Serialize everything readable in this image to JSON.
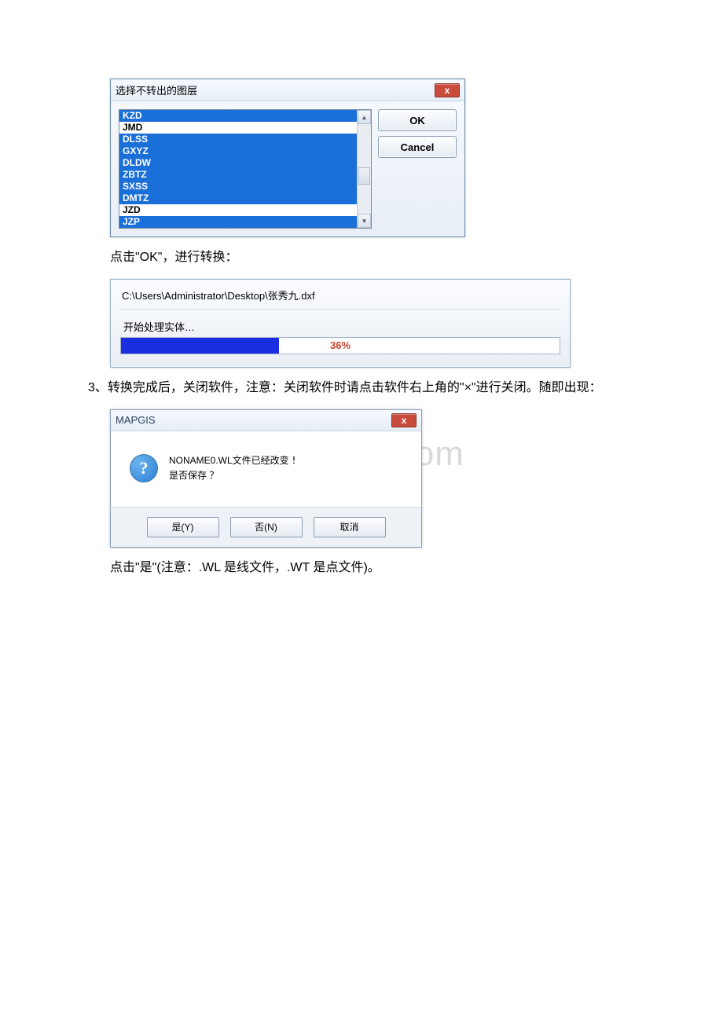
{
  "dialog1": {
    "title": "选择不转出的图层",
    "close_glyph": "x",
    "items": [
      {
        "label": "KZD",
        "selected": true
      },
      {
        "label": "JMD",
        "selected": false
      },
      {
        "label": "DLSS",
        "selected": true
      },
      {
        "label": "GXYZ",
        "selected": true
      },
      {
        "label": "DLDW",
        "selected": true
      },
      {
        "label": "ZBTZ",
        "selected": true
      },
      {
        "label": "SXSS",
        "selected": true
      },
      {
        "label": "DMTZ",
        "selected": true
      },
      {
        "label": "JZD",
        "selected": false
      },
      {
        "label": "JZP",
        "selected": true
      }
    ],
    "ok_label": "OK",
    "cancel_label": "Cancel"
  },
  "para1": "点击\"OK\"，进行转换：",
  "progress": {
    "path": "C:\\Users\\Administrator\\Desktop\\张秀九.dxf",
    "label": "开始处理实体…",
    "percent_text": "36%",
    "percent_value": 36
  },
  "para2": "　　3、转换完成后，关闭软件，注意：关闭软件时请点击软件右上角的\"×\"进行关闭。随即出现：",
  "watermark_text": "www.bdocx.com",
  "msgbox": {
    "title": "MAPGIS",
    "close_glyph": "x",
    "line1": "NONAME0.WL文件已经改变 ！",
    "line2": "是否保存 ？",
    "yes": "是(Y)",
    "no": "否(N)",
    "cancel": "取消"
  },
  "para3": "点击\"是\"(注意：.WL 是线文件，.WT 是点文件)。"
}
